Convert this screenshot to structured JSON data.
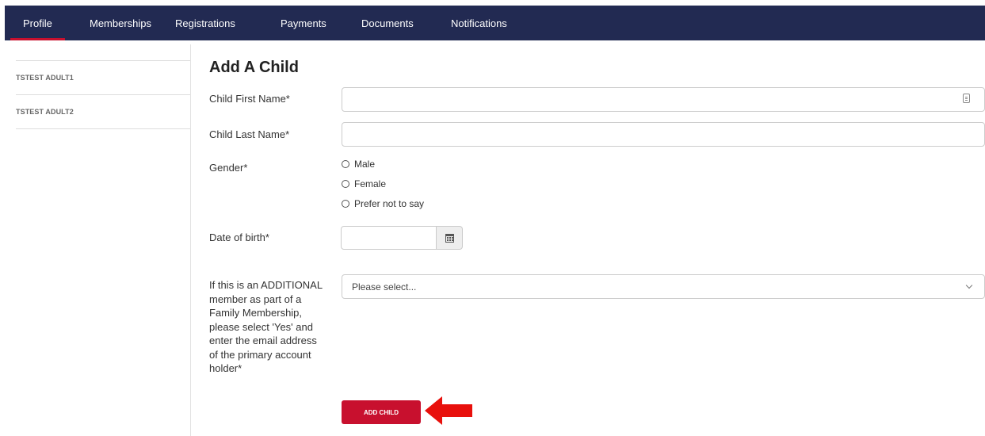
{
  "nav": {
    "tabs": [
      {
        "label": "Profile",
        "active": true
      },
      {
        "label": "Memberships"
      },
      {
        "label": "Registrations"
      },
      {
        "label": "Payments"
      },
      {
        "label": "Documents"
      },
      {
        "label": "Notifications"
      }
    ]
  },
  "sidebar": {
    "items": [
      {
        "label": "TSTEST ADULT1"
      },
      {
        "label": "TSTEST ADULT2"
      }
    ]
  },
  "form": {
    "title": "Add A Child",
    "first_name_label": "Child First Name*",
    "first_name_value": "",
    "last_name_label": "Child Last Name*",
    "last_name_value": "",
    "gender_label": "Gender*",
    "gender_options": [
      "Male",
      "Female",
      "Prefer not to say"
    ],
    "dob_label": "Date of birth*",
    "dob_value": "",
    "additional_label": "If this is an ADDITIONAL member as part of a Family Membership, please select 'Yes' and enter the email address of the primary account holder*",
    "additional_select_value": "Please select...",
    "submit_label": "ADD CHILD"
  },
  "colors": {
    "nav_bg": "#222a52",
    "accent": "#c8102e",
    "arrow": "#e8100c"
  }
}
